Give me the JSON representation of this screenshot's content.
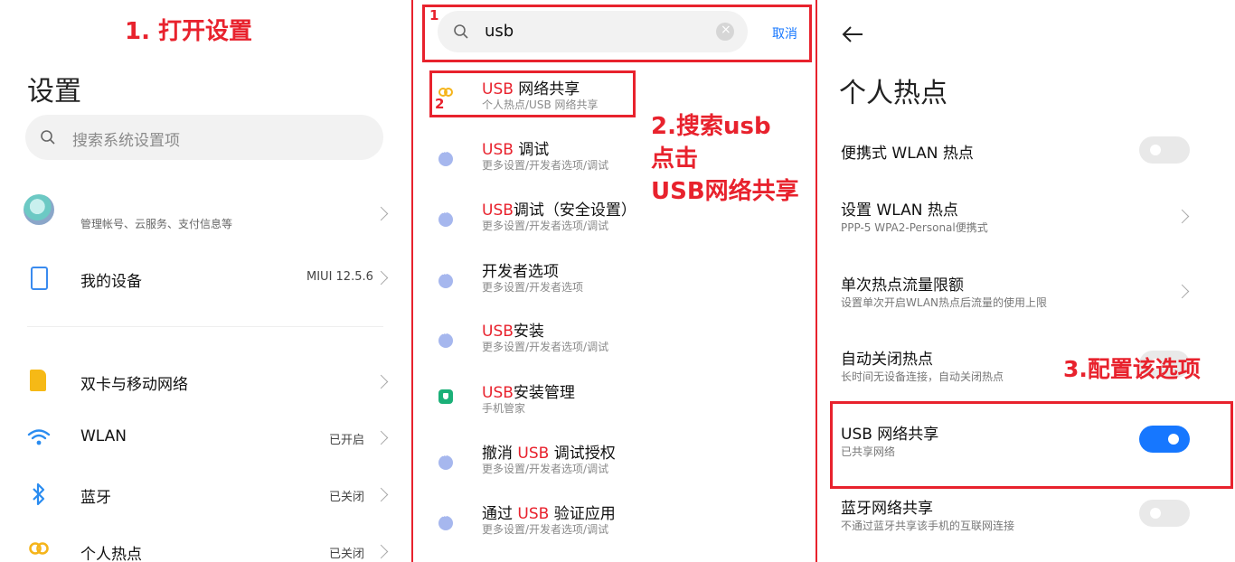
{
  "colors": {
    "annotation": "#e8222d",
    "accent": "#1677ff",
    "toggle_off": "#e9e9e9"
  },
  "annotations": {
    "step1": "1. 打开设置",
    "step2_lines": [
      "2.搜索usb",
      "点击",
      "USB网络共享"
    ],
    "step3": "3.配置该选项",
    "box1_num": "1",
    "box2_num": "2"
  },
  "settings": {
    "title": "设置",
    "search_placeholder": "搜索系统设置项",
    "account_sub": "管理帐号、云服务、支付信息等",
    "items": [
      {
        "icon": "phone-icon",
        "label": "我的设备",
        "value": "MIUI 12.5.6"
      },
      {
        "icon": "sim-card-icon",
        "label": "双卡与移动网络",
        "value": ""
      },
      {
        "icon": "wifi-icon",
        "label": "WLAN",
        "value": "已开启"
      },
      {
        "icon": "bluetooth-icon",
        "label": "蓝牙",
        "value": "已关闭"
      },
      {
        "icon": "hotspot-icon",
        "label": "个人热点",
        "value": "已关闭"
      }
    ]
  },
  "search": {
    "query": "usb",
    "cancel": "取消",
    "results": [
      {
        "icon": "hotspot-icon",
        "parts": [
          [
            "USB",
            true
          ],
          [
            " 网络共享",
            false
          ]
        ],
        "sub": "个人热点/USB 网络共享"
      },
      {
        "icon": "more-icon",
        "parts": [
          [
            "USB",
            true
          ],
          [
            " 调试",
            false
          ]
        ],
        "sub": "更多设置/开发者选项/调试"
      },
      {
        "icon": "more-icon",
        "parts": [
          [
            "USB",
            true
          ],
          [
            "调试（安全设置）",
            false
          ]
        ],
        "sub": "更多设置/开发者选项/调试"
      },
      {
        "icon": "more-icon",
        "parts": [
          [
            "开发者选项",
            false
          ]
        ],
        "sub": "更多设置/开发者选项"
      },
      {
        "icon": "more-icon",
        "parts": [
          [
            "USB",
            true
          ],
          [
            "安装",
            false
          ]
        ],
        "sub": "更多设置/开发者选项/调试"
      },
      {
        "icon": "shield-icon",
        "parts": [
          [
            "USB",
            true
          ],
          [
            "安装管理",
            false
          ]
        ],
        "sub": "手机管家"
      },
      {
        "icon": "more-icon",
        "parts": [
          [
            "撤消 ",
            false
          ],
          [
            "USB",
            true
          ],
          [
            " 调试授权",
            false
          ]
        ],
        "sub": "更多设置/开发者选项/调试"
      },
      {
        "icon": "more-icon",
        "parts": [
          [
            "通过 ",
            false
          ],
          [
            "USB",
            true
          ],
          [
            " 验证应用",
            false
          ]
        ],
        "sub": "更多设置/开发者选项/调试"
      }
    ]
  },
  "hotspot": {
    "title": "个人热点",
    "items": [
      {
        "label": "便携式 WLAN 热点",
        "sub": "",
        "control": "toggle",
        "on": false
      },
      {
        "label": "设置 WLAN 热点",
        "sub": "PPP-5 WPA2-Personal便携式",
        "control": "chevron"
      },
      {
        "label": "单次热点流量限额",
        "sub": "设置单次开启WLAN热点后流量的使用上限",
        "control": "chevron"
      },
      {
        "label": "自动关闭热点",
        "sub": "长时间无设备连接，自动关闭热点",
        "control": "toggle",
        "on": false
      },
      {
        "label": "USB 网络共享",
        "sub": "已共享网络",
        "control": "toggle",
        "on": true
      },
      {
        "label": "蓝牙网络共享",
        "sub": "不通过蓝牙共享该手机的互联网连接",
        "control": "toggle",
        "on": false
      }
    ]
  }
}
